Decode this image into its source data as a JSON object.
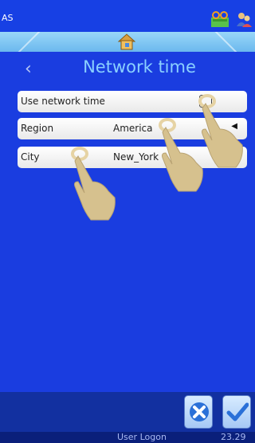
{
  "status": {
    "title": "AS"
  },
  "header": {
    "title": "Network time"
  },
  "settings": {
    "rows": [
      {
        "label": "Use network time",
        "control": "checkbox"
      },
      {
        "label": "Region",
        "value": "America"
      },
      {
        "label": "City",
        "value": "New_York"
      }
    ]
  },
  "footer": {
    "user_label": "User Logon",
    "time": "23.29"
  },
  "colors": {
    "background": "#1a3de0",
    "accent": "#8ad0ff",
    "homebar": "#9ad7f8"
  },
  "icons": [
    "printer-icon",
    "user-switch-icon",
    "home-icon",
    "back-chevron-icon",
    "cancel-icon",
    "confirm-icon",
    "tap-gesture-icon"
  ]
}
